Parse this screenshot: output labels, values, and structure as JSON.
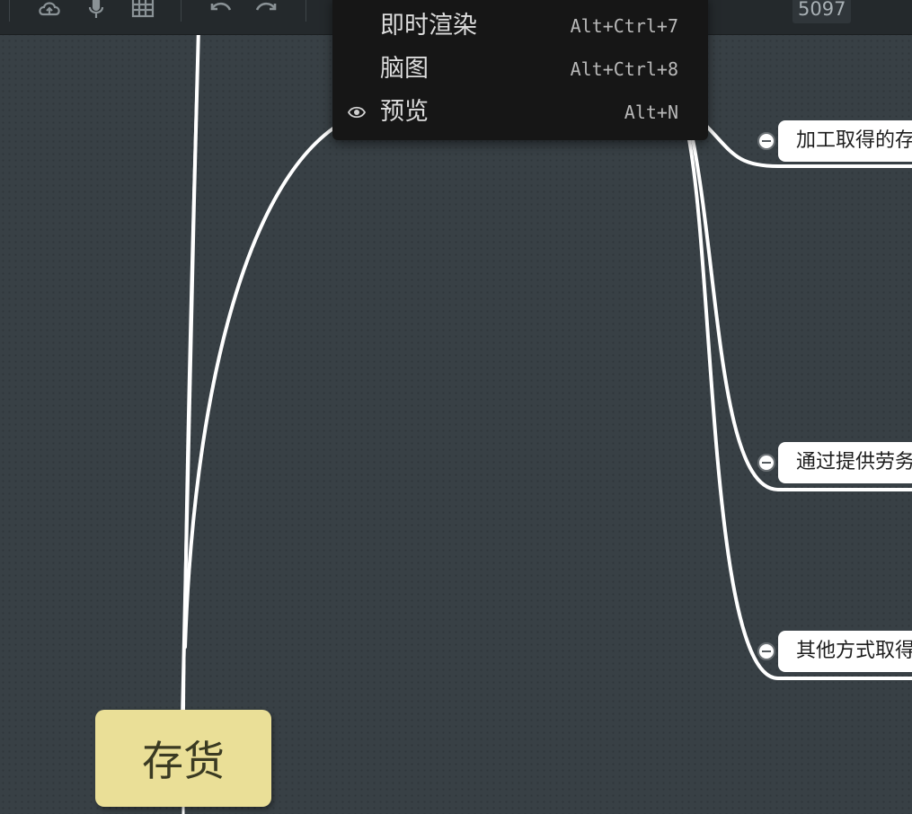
{
  "toolbar": {
    "icons": [
      "cloud-upload-icon",
      "microphone-icon",
      "table-icon",
      "undo-icon",
      "redo-icon"
    ],
    "counter": "5097"
  },
  "menu": {
    "items": [
      {
        "label": "即时渲染",
        "shortcut": "Alt+Ctrl+7",
        "checked": false
      },
      {
        "label": "脑图",
        "shortcut": "Alt+Ctrl+8",
        "checked": false
      },
      {
        "label": "预览",
        "shortcut": "Alt+N",
        "checked": true,
        "icon": "eye-icon"
      }
    ]
  },
  "mindmap": {
    "root": "存货",
    "branches": [
      {
        "label": "加工取得的存"
      },
      {
        "label": "通过提供劳务"
      },
      {
        "label": "其他方式取得"
      }
    ]
  },
  "colors": {
    "canvas": "#384045",
    "toolbar": "#24292c",
    "menu": "#161616",
    "root_fill": "#eadf97",
    "node_fill": "#ffffff",
    "wire": "#ffffff"
  }
}
